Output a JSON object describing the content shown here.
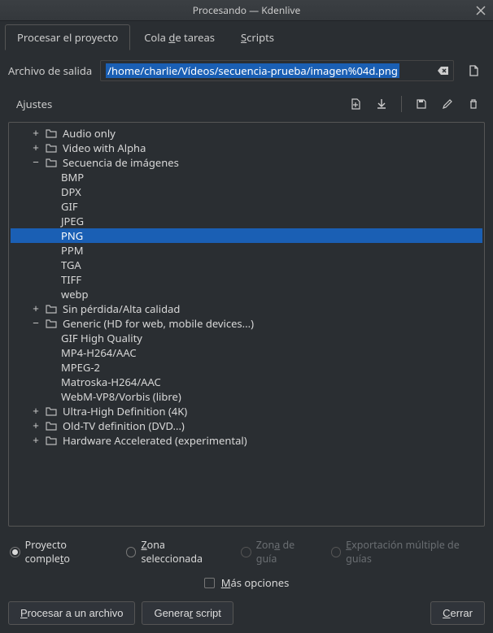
{
  "window": {
    "title": "Procesando — Kdenlive"
  },
  "tabs": {
    "render": "Procesar el proyecto",
    "queue": "Cola de tareas",
    "scripts": "Scripts"
  },
  "output": {
    "label": "Archivo de salida",
    "path": "/home/charlie/Vídeos/secuencia-prueba/imagen%04d.png"
  },
  "settings": {
    "label": "Ajustes"
  },
  "tree": [
    {
      "type": "folder",
      "expanded": false,
      "label": "Audio only"
    },
    {
      "type": "folder",
      "expanded": false,
      "label": "Video with Alpha"
    },
    {
      "type": "folder",
      "expanded": true,
      "label": "Secuencia de imágenes",
      "children": [
        {
          "label": "BMP"
        },
        {
          "label": "DPX"
        },
        {
          "label": "GIF"
        },
        {
          "label": "JPEG"
        },
        {
          "label": "PNG",
          "selected": true
        },
        {
          "label": "PPM"
        },
        {
          "label": "TGA"
        },
        {
          "label": "TIFF"
        },
        {
          "label": "webp"
        }
      ]
    },
    {
      "type": "folder",
      "expanded": false,
      "label": "Sin pérdida/Alta calidad"
    },
    {
      "type": "folder",
      "expanded": true,
      "label": "Generic (HD for web, mobile devices...)",
      "children": [
        {
          "label": "GIF High Quality"
        },
        {
          "label": "MP4-H264/AAC"
        },
        {
          "label": "MPEG-2"
        },
        {
          "label": "Matroska-H264/AAC"
        },
        {
          "label": "WebM-VP8/Vorbis (libre)"
        }
      ]
    },
    {
      "type": "folder",
      "expanded": false,
      "label": "Ultra-High Definition (4K)"
    },
    {
      "type": "folder",
      "expanded": false,
      "label": "Old-TV definition (DVD...)"
    },
    {
      "type": "folder",
      "expanded": false,
      "label": "Hardware Accelerated (experimental)"
    }
  ],
  "range": {
    "full": "Proyecto completo",
    "zone": "Zona seleccionada",
    "guide": "Zona de guía",
    "multi": "Exportación múltiple de guías"
  },
  "more_options": "Más opciones",
  "buttons": {
    "to_file": "Procesar a un archivo",
    "gen_script": "Generar script",
    "close": "Cerrar"
  }
}
